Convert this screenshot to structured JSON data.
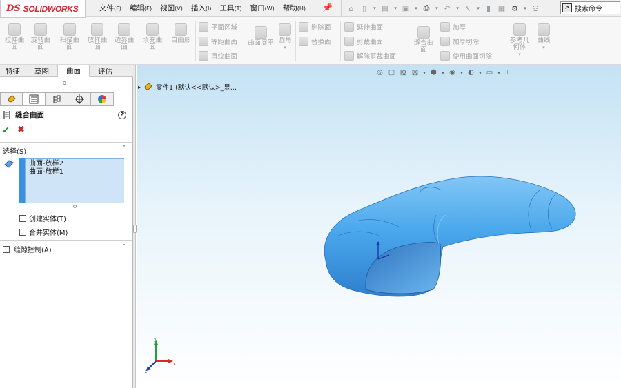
{
  "app": {
    "logo_ds": "DS",
    "logo_name": "SOLIDWORKS"
  },
  "menu": [
    {
      "label": "文件",
      "key": "(F)"
    },
    {
      "label": "编辑",
      "key": "(E)"
    },
    {
      "label": "视图",
      "key": "(V)"
    },
    {
      "label": "插入",
      "key": "(I)"
    },
    {
      "label": "工具",
      "key": "(T)"
    },
    {
      "label": "窗口",
      "key": "(W)"
    },
    {
      "label": "帮助",
      "key": "(H)"
    }
  ],
  "search": {
    "placeholder": "搜索命令"
  },
  "ribbon": {
    "big": [
      {
        "label": "拉伸曲面"
      },
      {
        "label": "旋转曲面"
      },
      {
        "label": "扫描曲面"
      },
      {
        "label": "放样曲面"
      },
      {
        "label": "边界曲面"
      },
      {
        "label": "填充曲面"
      },
      {
        "label": "自由形"
      }
    ],
    "col1": [
      "平面区域",
      "等距曲面",
      "直纹曲面"
    ],
    "expand": "曲面展平",
    "fillet": "圆角",
    "col2": [
      "删除面",
      "替换面"
    ],
    "col3": [
      "延伸曲面",
      "剪裁曲面",
      "解除剪裁曲面"
    ],
    "knit": "缝合曲面",
    "col4": [
      "加厚",
      "加厚切除",
      "使用曲面切除"
    ],
    "refgeo": "参考几何体",
    "curves": "曲线"
  },
  "tabs": [
    "特征",
    "草图",
    "曲面",
    "评估"
  ],
  "active_tab": "曲面",
  "property_manager": {
    "title": "缝合曲面",
    "help": "?",
    "section_selection": "选择(S)",
    "selections": [
      "曲面-放样2",
      "曲面-放样1"
    ],
    "opt_create_solid": "创建实体(T)",
    "opt_merge": "合并实体(M)",
    "gap_control": "缝隙控制(A)"
  },
  "tree": {
    "part_label": "零件1  (默认<<默认>_显..."
  },
  "triad": {
    "x": "x",
    "y": "y",
    "z": "z"
  },
  "colors": {
    "accent": "#3d8fe0",
    "model": "#4aa8ec",
    "brand": "#d7262c"
  }
}
